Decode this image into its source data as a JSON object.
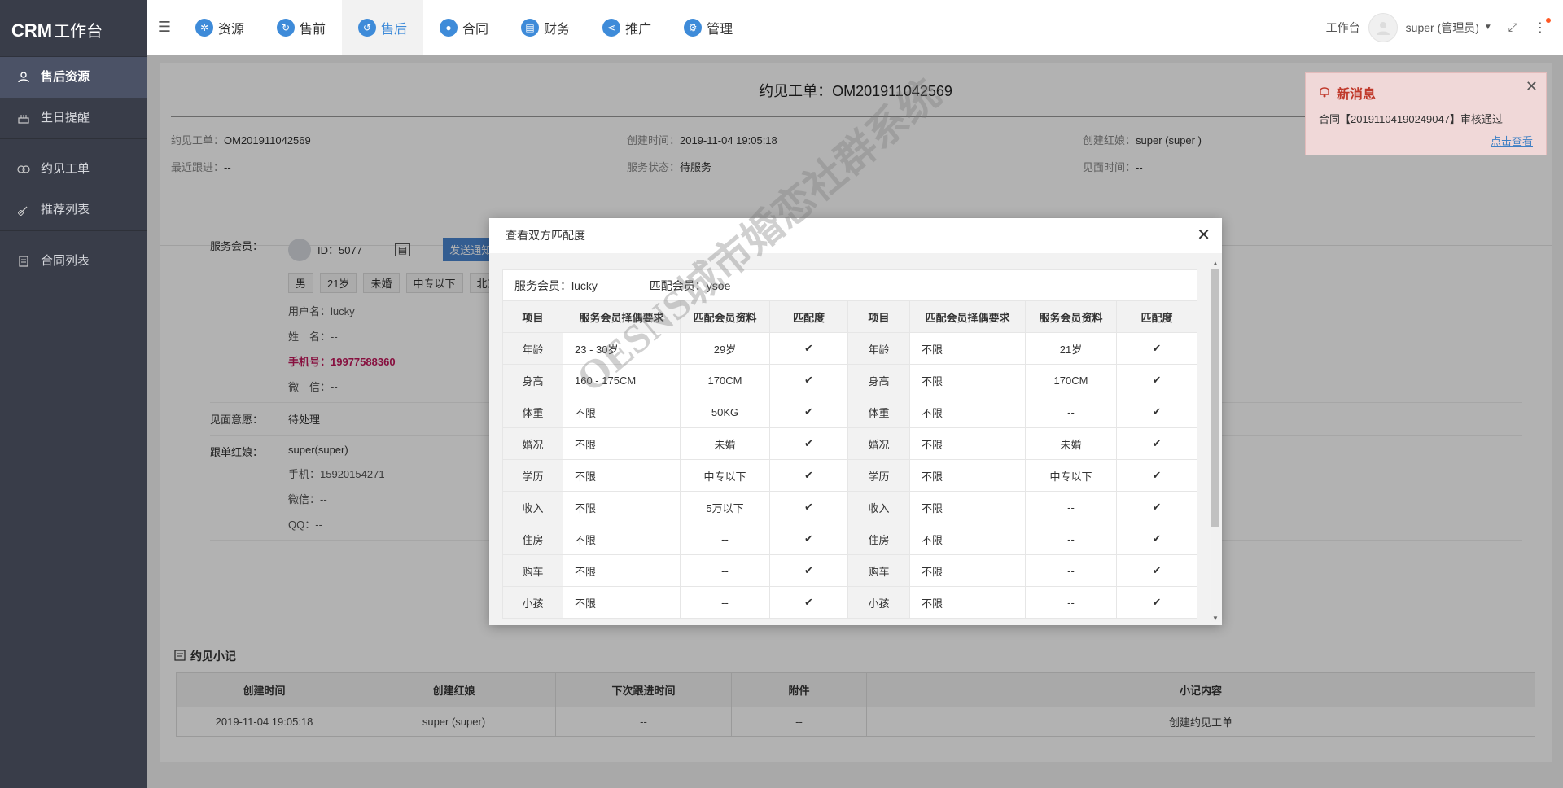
{
  "app": {
    "brand": "CRM",
    "brand_sub": "工作台"
  },
  "sidebar": {
    "items": [
      {
        "label": "售后资源",
        "icon": "user-icon"
      },
      {
        "label": "生日提醒",
        "icon": "cake-icon"
      },
      {
        "label": "约见工单",
        "icon": "heart-link-icon"
      },
      {
        "label": "推荐列表",
        "icon": "link-icon"
      },
      {
        "label": "合同列表",
        "icon": "document-icon"
      }
    ]
  },
  "topnav": {
    "items": [
      {
        "label": "资源"
      },
      {
        "label": "售前"
      },
      {
        "label": "售后"
      },
      {
        "label": "合同"
      },
      {
        "label": "财务"
      },
      {
        "label": "推广"
      },
      {
        "label": "管理"
      }
    ],
    "workbench": "工作台",
    "user": "super (管理员)"
  },
  "order": {
    "title": "约见工单：OM201911042569",
    "fields": [
      {
        "label": "约见工单：",
        "value": "OM201911042569"
      },
      {
        "label": "创建时间：",
        "value": "2019-11-04 19:05:18"
      },
      {
        "label": "创建红娘：",
        "value": "super (super )"
      },
      {
        "label": "最近跟进：",
        "value": "--"
      },
      {
        "label": "服务状态：",
        "value": "待服务"
      },
      {
        "label": "见面时间：",
        "value": "--"
      }
    ],
    "service_member_label": "服务会员：",
    "member_id": "ID：5077",
    "notify_btn": "发送通知",
    "tags": [
      "男",
      "21岁",
      "未婚",
      "中专以下",
      "北京"
    ],
    "username_label": "用户名：",
    "username": "lucky",
    "name_label": "姓　名：",
    "name": "--",
    "phone_label": "手机号：",
    "phone": "19977588360",
    "wechat_label": "微　信：",
    "wechat": "--",
    "meet_will_label": "见面意愿：",
    "meet_will": "待处理",
    "matchmaker_label": "跟单红娘：",
    "matchmaker": "super(super)",
    "mm_phone_label": "手机：",
    "mm_phone": "15920154271",
    "mm_wechat_label": "微信：",
    "mm_wechat": "--",
    "mm_qq_label": "QQ：",
    "mm_qq": "--"
  },
  "notes": {
    "title": "约见小记",
    "headers": [
      "创建时间",
      "创建红娘",
      "下次跟进时间",
      "附件",
      "小记内容"
    ],
    "rows": [
      [
        "2019-11-04 19:05:18",
        "super (super)",
        "--",
        "--",
        "创建约见工单"
      ]
    ]
  },
  "notification": {
    "title": "新消息",
    "body": "合同【20191104190249047】审核通过",
    "link": "点击查看"
  },
  "modal": {
    "title": "查看双方匹配度",
    "service_member": "服务会员：lucky",
    "match_member": "匹配会员：ysoe",
    "headers": [
      "项目",
      "服务会员择偶要求",
      "匹配会员资料",
      "匹配度",
      "项目",
      "匹配会员择偶要求",
      "服务会员资料",
      "匹配度"
    ],
    "check": "✔",
    "rows": [
      [
        "年龄",
        "23 - 30岁",
        "29岁",
        "年龄",
        "不限",
        "21岁"
      ],
      [
        "身高",
        "160 - 175CM",
        "170CM",
        "身高",
        "不限",
        "170CM"
      ],
      [
        "体重",
        "不限",
        "50KG",
        "体重",
        "不限",
        "--"
      ],
      [
        "婚况",
        "不限",
        "未婚",
        "婚况",
        "不限",
        "未婚"
      ],
      [
        "学历",
        "不限",
        "中专以下",
        "学历",
        "不限",
        "中专以下"
      ],
      [
        "收入",
        "不限",
        "5万以下",
        "收入",
        "不限",
        "--"
      ],
      [
        "住房",
        "不限",
        "--",
        "住房",
        "不限",
        "--"
      ],
      [
        "购车",
        "不限",
        "--",
        "购车",
        "不限",
        "--"
      ],
      [
        "小孩",
        "不限",
        "--",
        "小孩",
        "不限",
        "--"
      ]
    ]
  },
  "watermark": "OESNS城市婚恋社群系统"
}
